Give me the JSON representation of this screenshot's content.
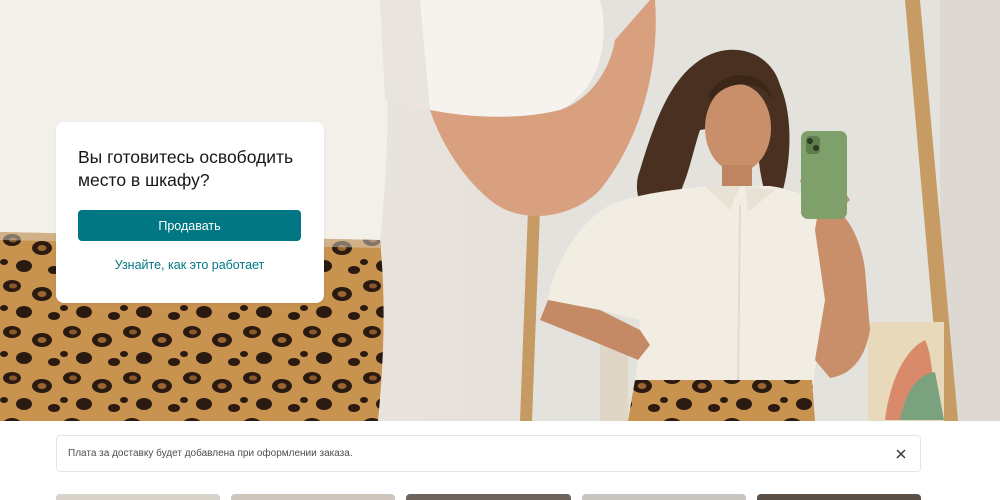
{
  "hero": {
    "title": "Вы готовитесь освободить место в шкафу?",
    "sell_button_label": "Продавать",
    "how_it_works_link": "Узнайте, как это работает"
  },
  "notice": {
    "text": "Плата за доставку будет добавлена при оформлении заказа.",
    "close_icon": "close-icon"
  },
  "colors": {
    "accent": "#007782",
    "notice_border": "#e5e5e5"
  },
  "thumbnails": [
    {
      "color": "#d7d3cb"
    },
    {
      "color": "#cfc6bd"
    },
    {
      "color": "#6d655d"
    },
    {
      "color": "#c9c6c2"
    },
    {
      "color": "#5a5048"
    }
  ]
}
